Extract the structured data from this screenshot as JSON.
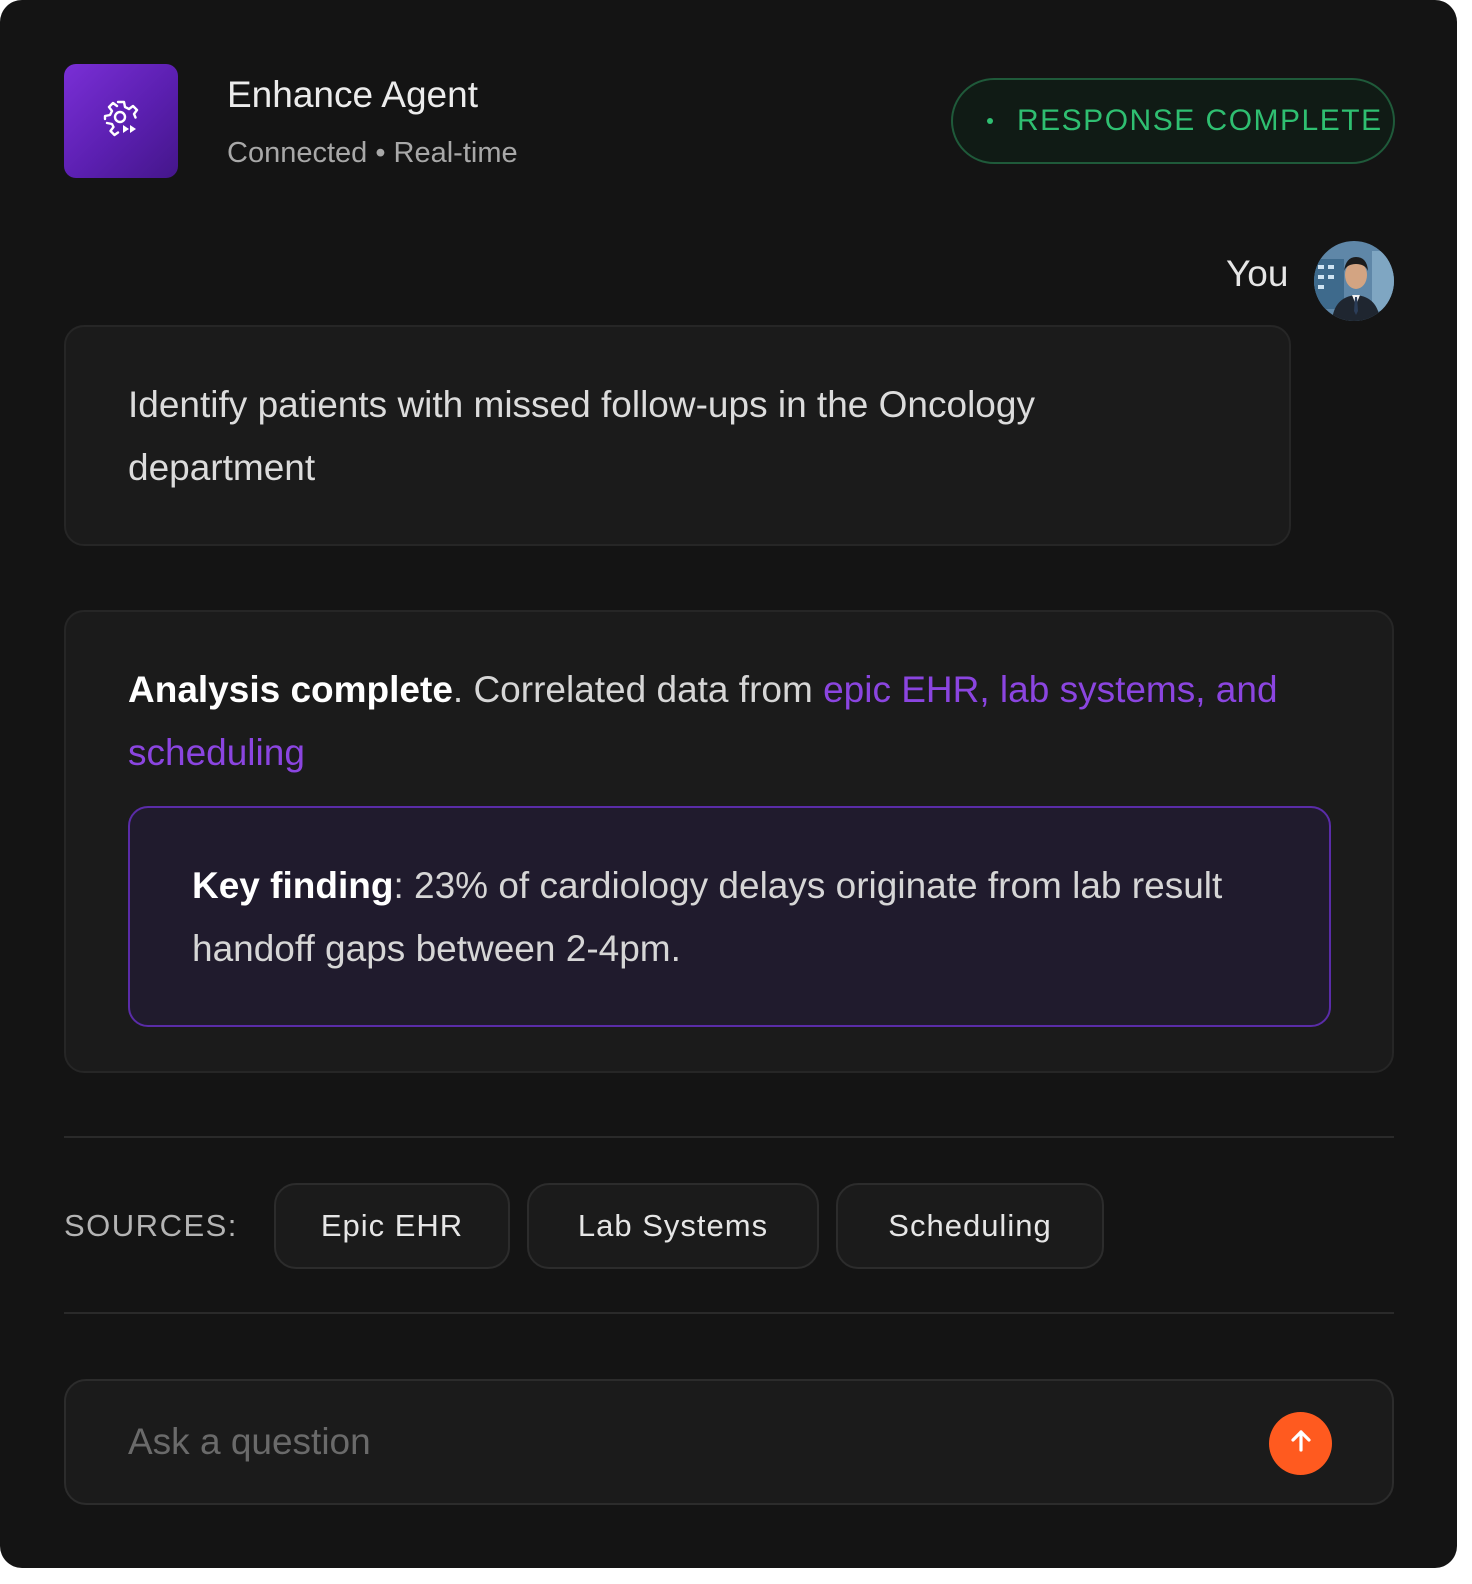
{
  "header": {
    "agent_name": "Enhance Agent",
    "agent_status": "Connected • Real-time",
    "logo_icon": "gear-play-icon",
    "status_badge": "RESPONSE COMPLETE"
  },
  "user": {
    "label": "You",
    "message": "Identify patients with missed follow-ups in the Oncology department"
  },
  "response": {
    "lead_bold": "Analysis complete",
    "lead_rest": ". Correlated data from ",
    "sources_inline": "epic EHR, lab systems, and scheduling",
    "finding_label": "Key finding",
    "finding_text": ": 23% of cardiology delays originate from lab result handoff gaps between 2-4pm."
  },
  "sources": {
    "label": "SOURCES:",
    "items": [
      "Epic EHR",
      "Lab Systems",
      "Scheduling"
    ]
  },
  "composer": {
    "placeholder": "Ask a question",
    "send_icon": "arrow-up-icon"
  },
  "colors": {
    "background": "#141414",
    "accent_purple": "#8b45e0",
    "status_green": "#2fbf71",
    "send_orange": "#ff5a1f"
  }
}
